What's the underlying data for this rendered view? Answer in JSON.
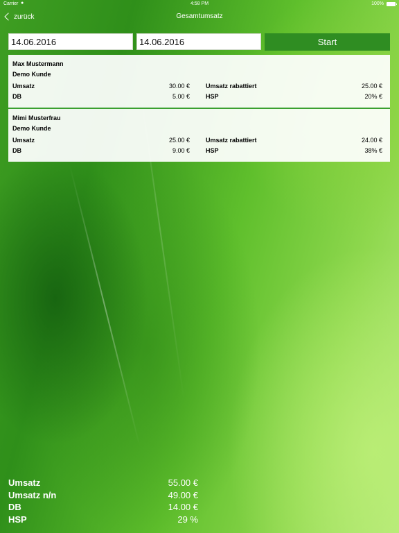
{
  "status_bar": {
    "carrier": "Carrier",
    "wifi_icon": "wifi-icon",
    "time": "4:58 PM",
    "battery": "100%",
    "battery_icon": "battery-icon"
  },
  "nav": {
    "back_label": "zurück",
    "back_icon": "chevron-left-icon",
    "title": "Gesamtumsatz"
  },
  "filter": {
    "date_from": "14.06.2016",
    "date_to": "14.06.2016",
    "start_label": "Start"
  },
  "entries": [
    {
      "name": "Max Mustermann",
      "customer": "Demo Kunde",
      "umsatz_label": "Umsatz",
      "umsatz": "30.00 €",
      "db_label": "DB",
      "db": "5.00 €",
      "umsatz_rabattiert_label": "Umsatz rabattiert",
      "umsatz_rabattiert": "25.00 €",
      "hsp_label": "HSP",
      "hsp": "20% €"
    },
    {
      "name": "Mimi Musterfrau",
      "customer": "Demo Kunde",
      "umsatz_label": "Umsatz",
      "umsatz": "25.00 €",
      "db_label": "DB",
      "db": "9.00 €",
      "umsatz_rabattiert_label": "Umsatz rabattiert",
      "umsatz_rabattiert": "24.00 €",
      "hsp_label": "HSP",
      "hsp": "38% €"
    }
  ],
  "totals": [
    {
      "label": "Umsatz",
      "value": "55.00 €"
    },
    {
      "label": "Umsatz n/n",
      "value": "49.00 €"
    },
    {
      "label": "DB",
      "value": "14.00 €"
    },
    {
      "label": "HSP",
      "value": "29 %"
    }
  ],
  "colors": {
    "accent": "#2f8d22",
    "separator": "#3aa030",
    "text_light": "#ffffff"
  }
}
